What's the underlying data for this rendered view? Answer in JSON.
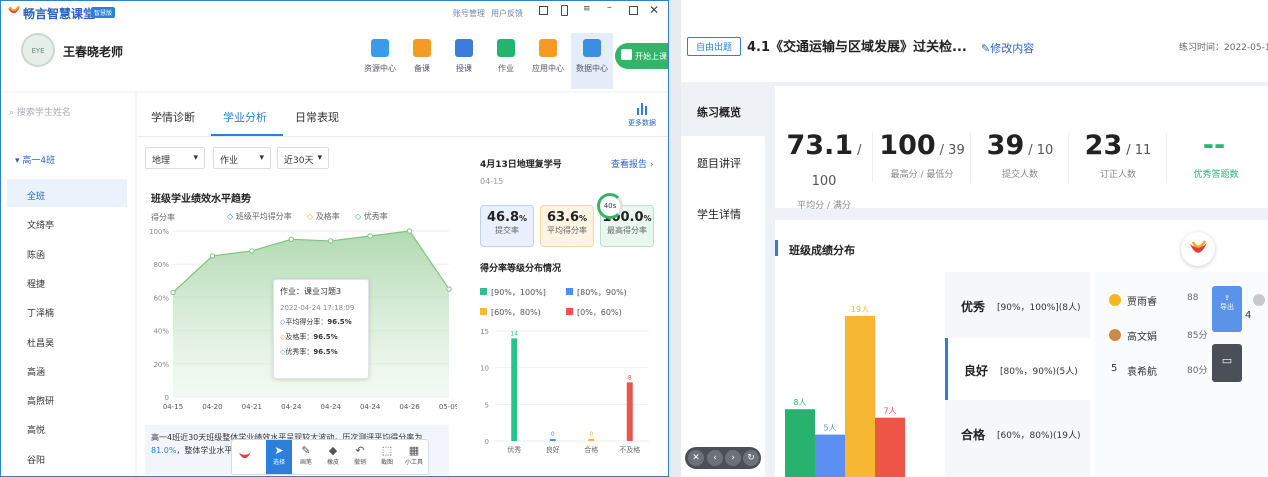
{
  "left_app": {
    "app_name": "畅言智慧课堂",
    "app_badge": "智慧版",
    "title_links": [
      "账号管理",
      "用户反馈"
    ],
    "teacher_name": "王春晓老师",
    "avatar_text": "EYE",
    "nav": [
      {
        "label": "资源中心",
        "color": "#3a9be8"
      },
      {
        "label": "备课",
        "color": "#f59a23"
      },
      {
        "label": "授课",
        "color": "#3b7bd9"
      },
      {
        "label": "作业",
        "color": "#26b36f"
      },
      {
        "label": "应用中心",
        "color": "#f59a23"
      },
      {
        "label": "数据中心",
        "color": "#3b8de0"
      }
    ],
    "start_class": "开始上课",
    "search_placeholder": "搜索学生姓名",
    "class_name": "高一4班",
    "students": [
      "全班",
      "文绮亭",
      "陈函",
      "程捷",
      "丁泽楠",
      "杜昌昊",
      "高涵",
      "高煦研",
      "高悦",
      "谷阳"
    ],
    "tabs": [
      "学情诊断",
      "学业分析",
      "日常表现"
    ],
    "active_tab": "学业分析",
    "more_label": "更多数据",
    "filters": [
      "地理",
      "作业",
      "近30天"
    ],
    "chart_title": "班级学业绩效水平趋势",
    "chart_subtitle": "得分率",
    "legend": [
      "班级平均得分率",
      "及格率",
      "优秀率"
    ],
    "tooltip": {
      "title": "作业：课业习题3",
      "time": "2022-04-24 17:18:09",
      "rows": [
        {
          "label": "平均得分率：",
          "value": "96.5%"
        },
        {
          "label": "及格率：",
          "value": "96.5%"
        },
        {
          "label": "优秀率：",
          "value": "96.5%"
        }
      ]
    },
    "summary": "高一4班近30天班级整体学业绩效水平呈现较大波动，历次测评平均得分率为",
    "summary_value": "81.0%",
    "summary2": "，整体学业水平良好，建",
    "toolbar": [
      "选择",
      "画笔",
      "橡皮",
      "撤销",
      "截图",
      "小工具"
    ],
    "right_panel": {
      "title": "4月13日地理复学号",
      "date": "04-15",
      "link": "查看报告",
      "stats": [
        {
          "value": "46.8",
          "unit": "%",
          "label": "提交率"
        },
        {
          "value": "63.6",
          "unit": "%",
          "label": "平均得分率"
        },
        {
          "value": "100.0",
          "unit": "%",
          "label": "最高得分率"
        }
      ],
      "ring_text": "40s",
      "dist_title": "得分率等级分布情况",
      "dist_legend": [
        "[90%，100%]",
        "[80%，90%)",
        "[60%，80%)",
        "[0%，60%)"
      ]
    }
  },
  "right_app": {
    "mode_badge": "自由出题",
    "title": "4.1《交通运输与区域发展》过关检...",
    "edit_link": "修改内容",
    "practice_time": "练习时间：2022-05-12",
    "menu": [
      "练习概览",
      "题目讲评",
      "学生详情"
    ],
    "active_menu": "练习概览",
    "kpis": [
      {
        "value": "73.1",
        "sub": "/ 100",
        "label": "平均分 / 满分"
      },
      {
        "value": "100",
        "sub": "/ 39",
        "label": "最高分 / 最低分"
      },
      {
        "value": "39",
        "sub": "/ 10",
        "label": "提交人数"
      },
      {
        "value": "23",
        "sub": "/ 11",
        "label": "订正人数"
      },
      {
        "value": "--",
        "sub": "",
        "label": "优秀答题数"
      }
    ],
    "section_title": "班级成绩分布",
    "grades": [
      {
        "name": "优秀",
        "desc": "[90%，100%](8人)"
      },
      {
        "name": "良好",
        "desc": "[80%，90%)(5人)"
      },
      {
        "name": "合格",
        "desc": "[60%，80%)(19人)"
      }
    ],
    "ranking": [
      {
        "rank": "1",
        "name": "贾雨睿",
        "score": "88"
      },
      {
        "rank": "3",
        "name": "高文娟",
        "score": "85分"
      },
      {
        "rank": "5",
        "name": "袁希航",
        "score": "80分"
      }
    ],
    "rank_extra": "4",
    "export_label": "导出"
  },
  "chart_data": [
    {
      "type": "area",
      "title": "班级学业绩效水平趋势",
      "ylabel": "得分率",
      "x": [
        "04-15",
        "04-20",
        "04-21",
        "04-24",
        "04-24",
        "04-24",
        "04-26",
        "05-09"
      ],
      "series": [
        {
          "name": "班级平均得分率",
          "values": [
            63,
            85,
            88,
            95,
            94,
            97,
            100,
            65
          ]
        }
      ],
      "yticks": [
        "0",
        "20%",
        "40%",
        "60%",
        "80%",
        "100%"
      ],
      "ylim": [
        0,
        100
      ],
      "color": "#5db66b"
    },
    {
      "type": "bar",
      "title": "得分率等级分布情况",
      "categories": [
        "优秀",
        "良好",
        "合格",
        "不及格"
      ],
      "values": [
        14,
        0,
        0,
        8
      ],
      "data_labels": [
        "14",
        "0",
        "0",
        "8"
      ],
      "colors": [
        "#2bc38a",
        "#4b8ff0",
        "#f6b93b",
        "#ef5350"
      ],
      "yticks": [
        "0",
        "5",
        "10",
        "15"
      ],
      "ylim": [
        0,
        15
      ]
    },
    {
      "type": "bar",
      "title": "班级成绩分布",
      "categories": [
        "优秀",
        "良好",
        "合格",
        "不及格"
      ],
      "values": [
        8,
        5,
        19,
        7
      ],
      "data_labels": [
        "8人",
        "5人",
        "19人",
        "7人"
      ],
      "colors": [
        "#27b36d",
        "#5b8ff2",
        "#f8b733",
        "#ee5547"
      ],
      "ylim": [
        0,
        19
      ]
    }
  ]
}
